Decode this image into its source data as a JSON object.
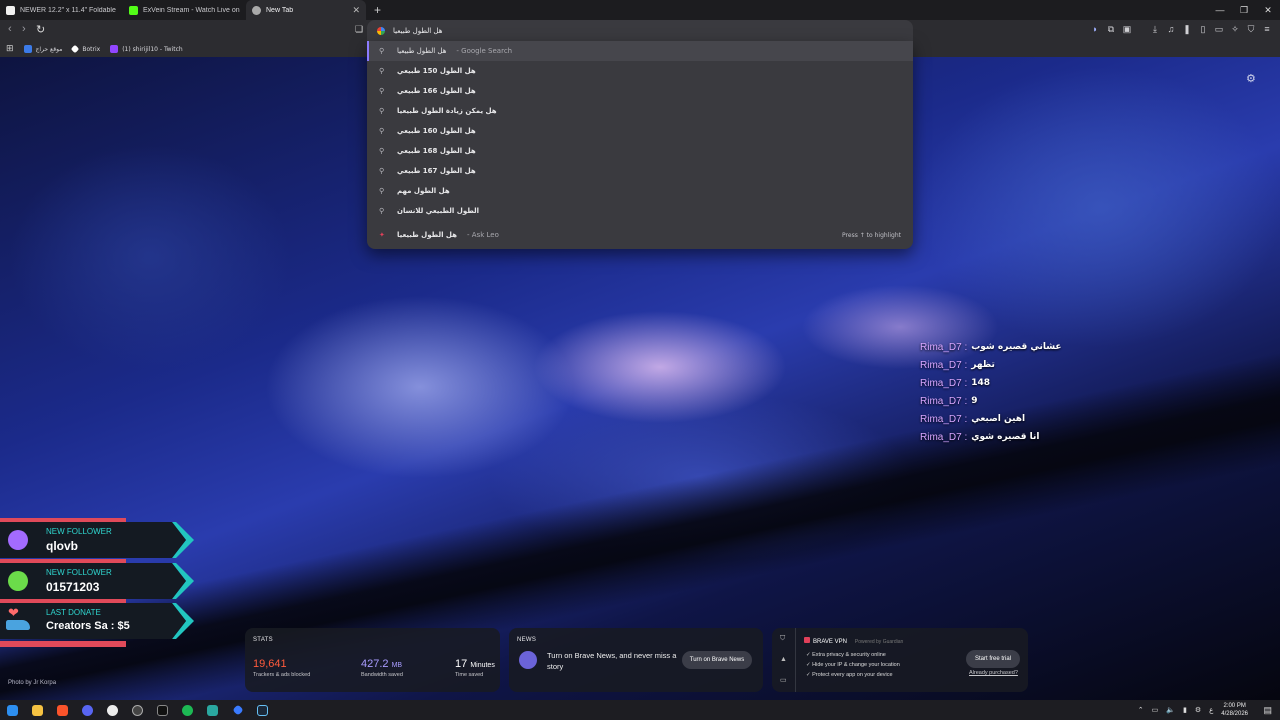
{
  "tabs": [
    {
      "title": "NEWER 12.2\" x 11.4\" Foldable Soft",
      "icon": "amazon-icon",
      "color": "#f0f0f0"
    },
    {
      "title": "ExVein Stream - Watch Live on Kick",
      "icon": "kick-icon",
      "color": "#53fc18"
    },
    {
      "title": "New Tab",
      "icon": "brave-icon",
      "color": "#aaaaaa"
    }
  ],
  "omnibox": {
    "value": "هل الطول طبيعيا"
  },
  "bookmarks": [
    {
      "label": "موقع حراج",
      "color": "#3c7be8"
    },
    {
      "label": "Botrix",
      "color": "#ffffff"
    },
    {
      "label": "(1) shirijil10 - Twitch",
      "color": "#9146ff"
    }
  ],
  "suggestions": [
    {
      "text": "هل الطول طبيعيا",
      "sub": "- Google Search"
    },
    {
      "text": "هل الطول 150 طبيعي",
      "sub": ""
    },
    {
      "text": "هل الطول 166 طبيعي",
      "sub": ""
    },
    {
      "text": "هل يمكن زيادة الطول طبيعيا",
      "sub": ""
    },
    {
      "text": "هل الطول 160 طبيعي",
      "sub": ""
    },
    {
      "text": "هل الطول 168 طبيعي",
      "sub": ""
    },
    {
      "text": "هل الطول 167 طبيعي",
      "sub": ""
    },
    {
      "text": "هل الطول مهم",
      "sub": ""
    },
    {
      "text": "الطول الطبيعي للانسان",
      "sub": ""
    }
  ],
  "leo": {
    "text": "هل الطول طبيعيا",
    "sub": "- Ask Leo",
    "hint": "Press ↑ to highlight"
  },
  "chat": [
    {
      "user": "Rima_D7 :",
      "msg": "عشاني قصيره شوب"
    },
    {
      "user": "Rima_D7 :",
      "msg": "تظهر"
    },
    {
      "user": "Rima_D7 :",
      "msg": "148"
    },
    {
      "user": "Rima_D7 :",
      "msg": "9"
    },
    {
      "user": "Rima_D7 :",
      "msg": "اهين اصبعي"
    },
    {
      "user": "Rima_D7 :",
      "msg": "انا قصيره شوي"
    }
  ],
  "alerts": [
    {
      "label": "NEW FOLLOWER",
      "value": "qlovb",
      "dot": "#a36bff"
    },
    {
      "label": "NEW FOLLOWER",
      "value": "01571203",
      "dot": "#6bdc4a"
    },
    {
      "label": "LAST DONATE",
      "value": "Creators Sa : $5"
    }
  ],
  "photo_credit": "Photo by Jr Korpa",
  "stats": {
    "title": "STATS",
    "trackers": {
      "value": "19,641",
      "desc": "Trackers & ads blocked"
    },
    "bandwidth": {
      "value": "427.2",
      "unit": "MB",
      "desc": "Bandwidth saved"
    },
    "time": {
      "value": "17",
      "unit": "Minutes",
      "desc": "Time saved"
    }
  },
  "news": {
    "title": "NEWS",
    "text": "Turn on Brave News, and never miss a story",
    "button": "Turn on Brave News"
  },
  "vpn": {
    "title": "BRAVE VPN",
    "powered": "Powered by Guardian",
    "features": [
      "Extra privacy & security online",
      "Hide your IP & change your location",
      "Protect every app on your device"
    ],
    "button": "Start free trial",
    "link": "Already purchased?"
  },
  "clock": {
    "time": "2:00 PM",
    "date": "4/28/2026"
  },
  "tray_lang": "ع",
  "colors": {
    "accent": "#8c7bff",
    "trackers": "#ff5a3c",
    "bandwidth": "#a99cff",
    "alert_cyan": "#2fd6cf",
    "alert_red": "#e04a5a"
  }
}
